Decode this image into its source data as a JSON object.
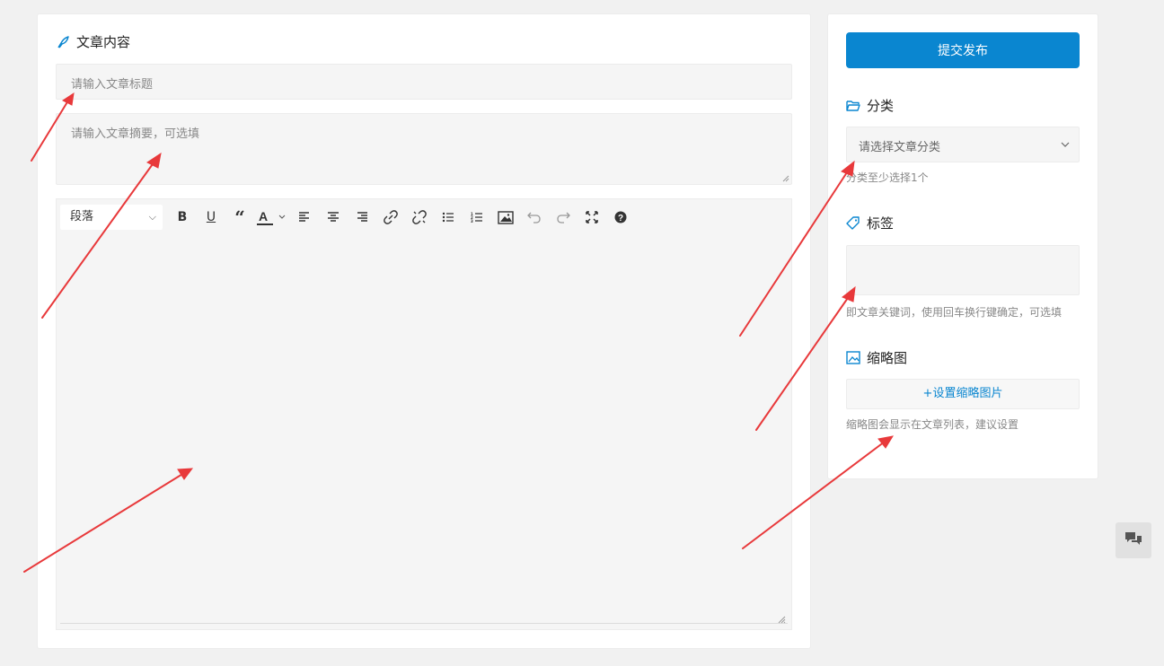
{
  "article": {
    "section_title": "文章内容",
    "title_placeholder": "请输入文章标题",
    "summary_placeholder": "请输入文章摘要，可选填",
    "editor": {
      "format_value": "段落",
      "toolbar_icons": [
        "bold-icon",
        "underline-icon",
        "blockquote-icon",
        "font-color-icon",
        "align-left-icon",
        "align-center-icon",
        "align-right-icon",
        "link-icon",
        "unlink-icon",
        "bullet-list-icon",
        "numbered-list-icon",
        "image-icon",
        "undo-icon",
        "redo-icon",
        "fullscreen-icon",
        "help-icon"
      ]
    }
  },
  "sidebar": {
    "submit_label": "提交发布",
    "category": {
      "title": "分类",
      "select_placeholder": "请选择文章分类",
      "hint": "分类至少选择1个"
    },
    "tags": {
      "title": "标签",
      "hint": "即文章关键词，使用回车换行键确定，可选填"
    },
    "thumbnail": {
      "title": "缩略图",
      "button_label": "+设置缩略图片",
      "hint": "缩略图会显示在文章列表，建议设置"
    }
  },
  "colors": {
    "accent": "#0a86d0",
    "annotation_arrow": "#e8393b",
    "page_bg": "#f1f1f1"
  },
  "floating": {
    "chat_icon": "chat-bubbles-icon"
  }
}
